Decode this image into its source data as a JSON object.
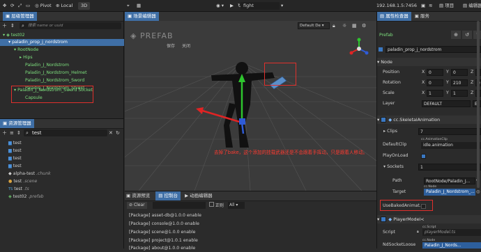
{
  "toolbar": {
    "pivot": "Pivot",
    "local": "Local",
    "mode3d": "3D",
    "scene_name": "fight",
    "ip": "192.168.1.5:7456",
    "project": "项目",
    "editor": "编辑器"
  },
  "hierarchy": {
    "title": "层级管理器",
    "search_placeholder": "搜索 name or uuid",
    "items": [
      "test02",
      "paladin_prop_j_nordstrom",
      "RootNode",
      "Hips",
      "Paladin_J_Nordstrom",
      "Paladin_J_Nordstrom_Helmet",
      "Paladin_J_Nordstrom_Sword",
      "Paladin_J_Nordstrom_Shield",
      "Paladin_J_Nordstrom_Sword Socket",
      "Capsule"
    ]
  },
  "scene": {
    "title": "场景编辑器",
    "watermark": "PREFAB",
    "btn_save": "保存",
    "btn_close": "关闭",
    "camera_mode": "Default De",
    "annotation": "去掉了bake，这个添加的挂载武器还是不会跟着手挥动，只是跟着人移动。"
  },
  "assets": {
    "title": "资源管理器",
    "search_value": "test",
    "items": [
      {
        "name": "test",
        "sub": ""
      },
      {
        "name": "test",
        "sub": ""
      },
      {
        "name": "test",
        "sub": ""
      },
      {
        "name": "test",
        "sub": ""
      },
      {
        "name": "alpha-test",
        "sub": ".chunk"
      },
      {
        "name": "test",
        "sub": ".scene"
      },
      {
        "name": "test",
        "sub": ".ts"
      },
      {
        "name": "test02",
        "sub": ".prefab"
      }
    ]
  },
  "console": {
    "tab_preview": "资源预览",
    "tab_console": "控制台",
    "tab_anim": "动画编辑器",
    "clear": "Clear",
    "regex": "正则",
    "all": "All",
    "lines": [
      "[Package] asset-db@1.0.0 enable",
      "[Package] console@1.0.0 enable",
      "[Package] scene@1.0.0 enable",
      "[Package] project@1.0.1 enable",
      "[Package] about@1.0.0 enable"
    ]
  },
  "inspector": {
    "title": "属性检查器",
    "tab_service": "服务",
    "prefab_label": "Prefab",
    "node_name": "paladin_prop_j_nordstrom",
    "node_section": "Node",
    "position": {
      "label": "Position",
      "x": "0",
      "y": "0"
    },
    "rotation": {
      "label": "Rotation",
      "x": "0",
      "y": "210",
      "z": "0"
    },
    "scale": {
      "label": "Scale",
      "x": "1",
      "y": "1"
    },
    "layer": {
      "label": "Layer",
      "value": "DEFAULT",
      "edit": "Ed"
    },
    "skeletal_section": "cc.SkeletalAnimation",
    "clips": {
      "label": "Clips",
      "value": "7"
    },
    "default_clip": {
      "label": "DefaultClip",
      "tag": "cc.AnimationClip",
      "value": "idle.animation"
    },
    "play_on_load": "PlayOnLoad",
    "sockets": {
      "label": "Sockets",
      "value": "1"
    },
    "path": {
      "label": "Path",
      "value": "RootNode/Paladin_J..."
    },
    "target": {
      "label": "Target",
      "tag": "cc.Node",
      "value": "Paladin_J_Nordstrom_..."
    },
    "use_baked": "UseBakedAnimat...",
    "player_section": "PlayerModel<",
    "script": {
      "label": "Script",
      "tag": "cc.Script",
      "value": "playerModel.ts"
    },
    "nd_socket": {
      "label": "NdSocketLoose",
      "tag": "cc.Node",
      "value": "Paladin_J_Nords..."
    }
  }
}
